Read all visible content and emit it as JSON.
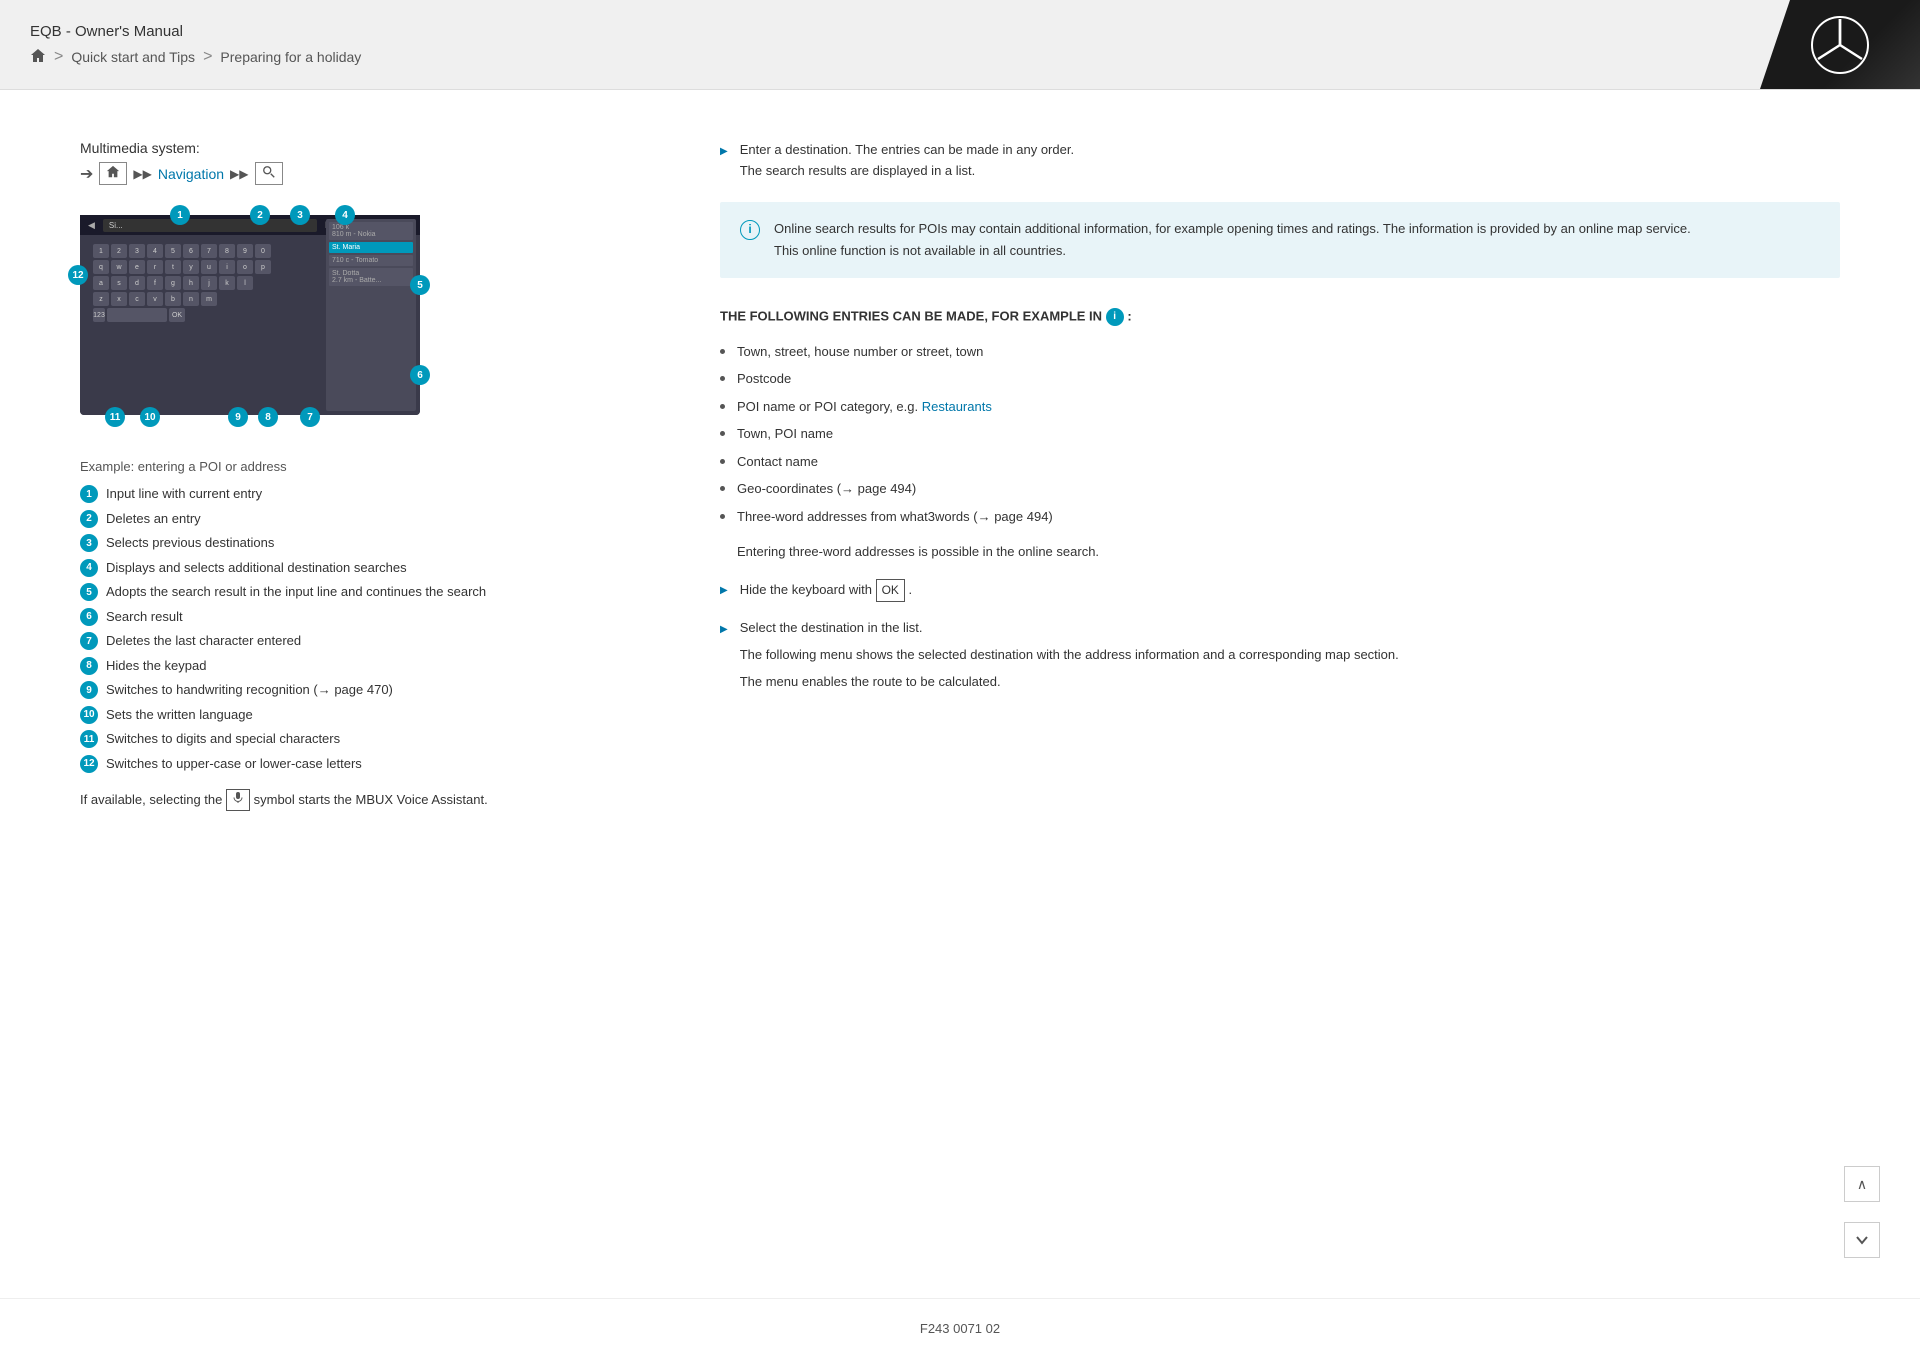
{
  "header": {
    "title": "EQB - Owner's Manual",
    "breadcrumb": {
      "home_aria": "Home",
      "sep1": ">",
      "link1": "Quick start and Tips",
      "sep2": ">",
      "current": "Preparing for a holiday"
    }
  },
  "nav_path": {
    "label": "Multimedia system:",
    "arrow": "➔",
    "icon1": "🏠",
    "dbl1": "▶▶",
    "link": "Navigation",
    "dbl2": "▶▶",
    "icon2": "🔍"
  },
  "device": {
    "label": "Example: entering a POI or address"
  },
  "legend": [
    {
      "num": "1",
      "text": "Input line with current entry"
    },
    {
      "num": "2",
      "text": "Deletes an entry"
    },
    {
      "num": "3",
      "text": "Selects previous destinations"
    },
    {
      "num": "4",
      "text": "Displays and selects additional destination searches"
    },
    {
      "num": "5",
      "text": "Adopts the search result in the input line and continues the search"
    },
    {
      "num": "6",
      "text": "Search result"
    },
    {
      "num": "7",
      "text": "Deletes the last character entered"
    },
    {
      "num": "8",
      "text": "Hides the keypad"
    },
    {
      "num": "9",
      "text": "Switches to handwriting recognition (→ page 470)"
    },
    {
      "num": "10",
      "text": "Sets the written language"
    },
    {
      "num": "11",
      "text": "Switches to digits and special characters"
    },
    {
      "num": "12",
      "text": "Switches to upper-case or lower-case letters"
    }
  ],
  "voice_note": "If available, selecting the",
  "voice_note2": "symbol starts the MBUX Voice Assistant.",
  "voice_icon_label": "🎤",
  "right": {
    "step1": {
      "text": "Enter a destination. The entries can be made in any order.\nThe search results are displayed in a list."
    },
    "info_box": {
      "text": "Online search results for POIs may contain additional information, for example opening times and ratings. The information is provided by an online map service.\nThis online function is not available in all countries."
    },
    "section_header": "THE FOLLOWING ENTRIES CAN BE MADE, FOR EXAMPLE IN",
    "section_header2": ":",
    "bullet_items": [
      {
        "text": "Town, street, house number or street, town"
      },
      {
        "text": "Postcode"
      },
      {
        "text": "POI name or POI category, e.g.",
        "link": "Restaurants",
        "link_text": true
      },
      {
        "text": "Town, POI name"
      },
      {
        "text": "Contact name"
      },
      {
        "text": "Geo-coordinates (→ page 494)"
      },
      {
        "text": "Three-word addresses from what3words (→ page 494)"
      }
    ],
    "sub_note": "Entering three-word addresses is possible in the online search.",
    "step2": "Hide the keyboard with",
    "ok_button": "OK",
    "step2_end": ".",
    "step3": "Select the destination in the list.",
    "step3_note1": "The following menu shows the selected destination with the address information and a corresponding map section.",
    "step3_note2": "The menu enables the route to be calculated."
  },
  "footer": {
    "doc_id": "F243 0071 02"
  },
  "scroll": {
    "up": "∧",
    "down": "⌄"
  }
}
